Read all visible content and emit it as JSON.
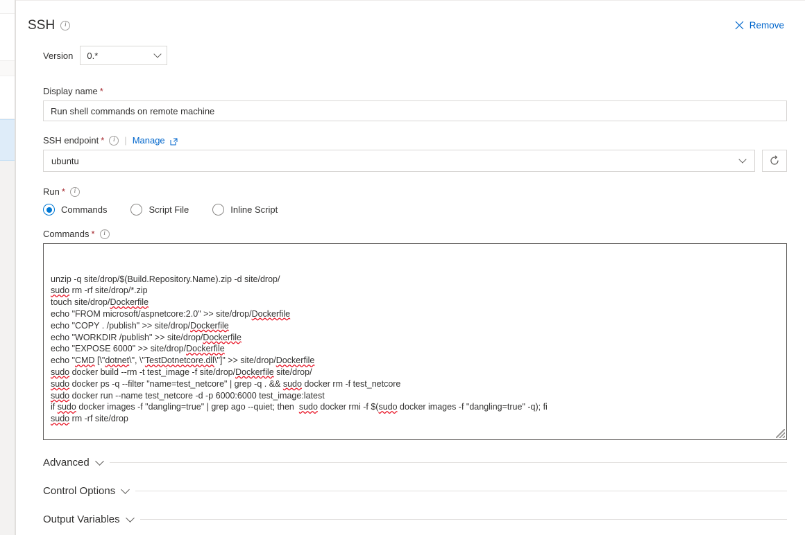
{
  "header": {
    "title": "SSH",
    "info_icon": "info-icon",
    "remove_label": "Remove",
    "close_icon": "close-icon"
  },
  "version": {
    "label": "Version",
    "value": "0.*",
    "chevron_icon": "chevron-down-icon"
  },
  "display_name": {
    "label": "Display name",
    "required_marker": "*",
    "value": "Run shell commands on remote machine"
  },
  "ssh_endpoint": {
    "label": "SSH endpoint",
    "required_marker": "*",
    "info_icon": "info-icon",
    "separator": "|",
    "manage_label": "Manage",
    "external_link_icon": "external-link-icon",
    "value": "ubuntu",
    "chevron_icon": "chevron-down-icon",
    "refresh_icon": "refresh-icon"
  },
  "run": {
    "label": "Run",
    "required_marker": "*",
    "info_icon": "info-icon",
    "options": [
      {
        "label": "Commands",
        "checked": true
      },
      {
        "label": "Script File",
        "checked": false
      },
      {
        "label": "Inline Script",
        "checked": false
      }
    ]
  },
  "commands": {
    "label": "Commands",
    "required_marker": "*",
    "info_icon": "info-icon",
    "lines": [
      "unzip -q site/drop/$(Build.Repository.Name).zip -d site/drop/",
      "sudo rm -rf site/drop/*.zip",
      "touch site/drop/Dockerfile",
      "echo \"FROM microsoft/aspnetcore:2.0\" >> site/drop/Dockerfile",
      "echo \"COPY . /publish\" >> site/drop/Dockerfile",
      "echo \"WORKDIR /publish\" >> site/drop/Dockerfile",
      "echo \"EXPOSE 6000\" >> site/drop/Dockerfile",
      "echo \"CMD [\\\"dotnet\\\", \\\"TestDotnetcore.dll\\\"]\" >> site/drop/Dockerfile",
      "sudo docker build --rm -t test_image -f site/drop/Dockerfile site/drop/",
      "sudo docker ps -q --filter \"name=test_netcore\" | grep -q . && sudo docker rm -f test_netcore",
      "sudo docker run --name test_netcore -d -p 6000:6000 test_image:latest",
      "if sudo docker images -f \"dangling=true\" | grep ago --quiet; then  sudo docker rmi -f $(sudo docker images -f \"dangling=true\" -q); fi",
      "sudo rm -rf site/drop"
    ],
    "misspelled_words": [
      "CMD",
      "dotnet",
      "TestDotnetcore.dll",
      "sudo",
      "Dockerfile"
    ]
  },
  "sections": [
    {
      "title": "Advanced",
      "chevron_icon": "chevron-down-icon"
    },
    {
      "title": "Control Options",
      "chevron_icon": "chevron-down-icon"
    },
    {
      "title": "Output Variables",
      "chevron_icon": "chevron-down-icon"
    }
  ],
  "colors": {
    "link": "#0066cc",
    "accent": "#0078d4",
    "required": "#a4262c",
    "border": "#d8d6d4",
    "focus_border": "#605e5c",
    "selection_highlight": "#deecf9",
    "spell_error": "#e81123"
  }
}
